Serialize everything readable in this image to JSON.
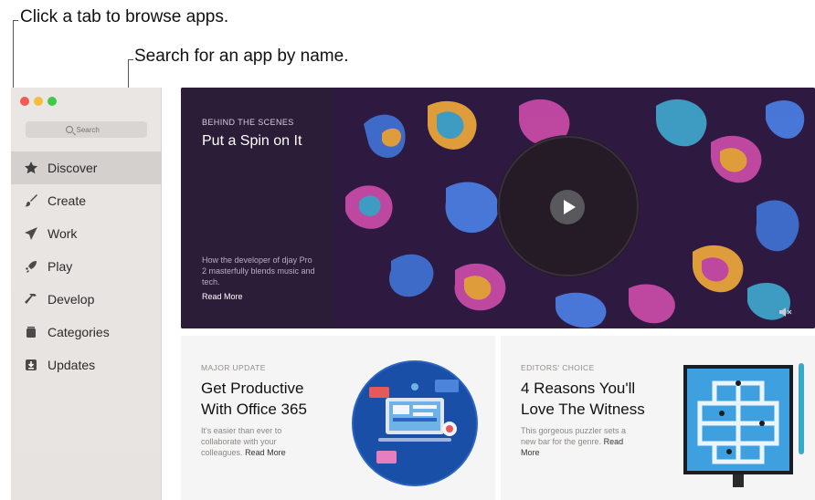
{
  "callouts": {
    "tabs": "Click a tab to browse apps.",
    "search": "Search for an app by name."
  },
  "search": {
    "placeholder": "Search"
  },
  "sidebar": {
    "items": [
      {
        "label": "Discover",
        "icon": "star-icon",
        "active": true
      },
      {
        "label": "Create",
        "icon": "brush-icon",
        "active": false
      },
      {
        "label": "Work",
        "icon": "paper-plane-icon",
        "active": false
      },
      {
        "label": "Play",
        "icon": "rocket-icon",
        "active": false
      },
      {
        "label": "Develop",
        "icon": "hammer-icon",
        "active": false
      },
      {
        "label": "Categories",
        "icon": "box-icon",
        "active": false
      },
      {
        "label": "Updates",
        "icon": "download-icon",
        "active": false
      }
    ]
  },
  "hero": {
    "eyebrow": "BEHIND THE SCENES",
    "title": "Put a Spin on It",
    "description": "How the developer of djay Pro 2 masterfully blends music and tech.",
    "read_more": "Read More"
  },
  "cards": [
    {
      "eyebrow": "MAJOR UPDATE",
      "title": "Get Productive With Office 365",
      "description": "It's easier than ever to collaborate with your colleagues.",
      "read_more": "Read More"
    },
    {
      "eyebrow": "EDITORS' CHOICE",
      "title": "4 Reasons You'll Love The Witness",
      "description": "This gorgeous puzzler sets a new bar for the genre.",
      "read_more": "Read More"
    }
  ],
  "colors": {
    "sidebar_bg": "#e9e6e4",
    "active_tab": "#d3d0ce",
    "hero_bg": "#2c1a3b",
    "card_bg": "#f6f5f5"
  }
}
